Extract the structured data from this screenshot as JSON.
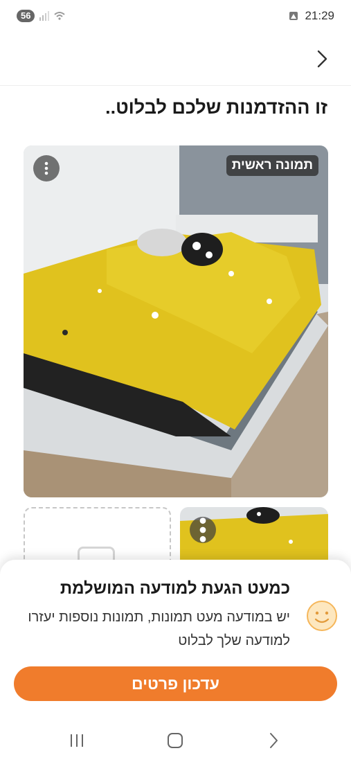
{
  "status_bar": {
    "badge": "56",
    "time": "21:29"
  },
  "header": {
    "back_icon": "chevron-right-icon"
  },
  "page": {
    "title": "זו ההזדמנות שלכם לבלוט.."
  },
  "gallery": {
    "main_badge": "תמונה ראשית",
    "menu_icon": "more-vertical-icon",
    "add_photo_icon": "image-placeholder-icon"
  },
  "sheet": {
    "title": "כמעט הגעת למודעה המושלמת",
    "body": "יש במודעה מעט תמונות, תמונות נוספות יעזרו למודעה שלך לבלוט",
    "icon": "smiley-icon",
    "cta_label": "עדכון פרטים",
    "accent": "#f07c2c"
  },
  "nav": {
    "recent_icon": "recent-apps-icon",
    "home_icon": "home-icon",
    "back_icon": "back-icon"
  }
}
